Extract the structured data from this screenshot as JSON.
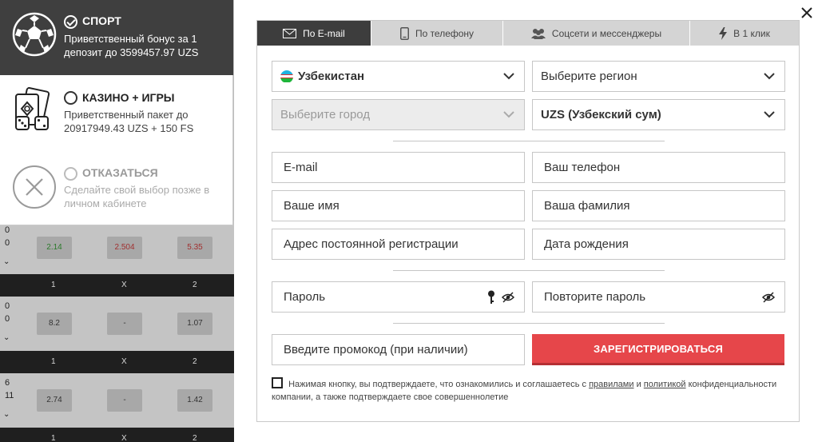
{
  "bonus": {
    "options": [
      {
        "title": "СПОРТ",
        "description": "Приветственный бонус за 1 депозит до 3599457.97 UZS",
        "selected": true,
        "icon": "soccer-ball-icon"
      },
      {
        "title": "КАЗИНО + ИГРЫ",
        "description": "Приветственный пакет до 20917949.43 UZS + 150 FS",
        "selected": false,
        "icon": "casino-cards-dice-icon"
      },
      {
        "title": "ОТКАЗАТЬСЯ",
        "description": "Сделайте свой выбор позже в личном кабинете",
        "selected": false,
        "icon": "decline-x-icon"
      }
    ]
  },
  "background_odds": {
    "rows": [
      {
        "score": [
          "0",
          "0"
        ],
        "odds": [
          "2.14",
          "2.504",
          "5.35"
        ]
      },
      {
        "score": [
          "0",
          "0"
        ],
        "odds": [
          "8.2",
          "-",
          "1.07"
        ]
      },
      {
        "score": [
          "6",
          "11"
        ],
        "odds": [
          "2.74",
          "-",
          "1.42"
        ]
      }
    ],
    "header_labels": [
      "1",
      "X",
      "2"
    ]
  },
  "tabs": [
    {
      "label": "По E-mail",
      "icon": "envelope-icon",
      "active": true
    },
    {
      "label": "По телефону",
      "icon": "phone-icon",
      "active": false
    },
    {
      "label": "Соцсети и мессенджеры",
      "icon": "people-icon",
      "active": false
    },
    {
      "label": "В 1 клик",
      "icon": "lightning-icon",
      "active": false
    }
  ],
  "form": {
    "country": "Узбекистан",
    "region_placeholder": "Выберите регион",
    "city_placeholder": "Выберите город",
    "currency": "UZS (Узбекский сум)",
    "email_placeholder": "E-mail",
    "phone_placeholder": "Ваш телефон",
    "first_name_placeholder": "Ваше имя",
    "last_name_placeholder": "Ваша фамилия",
    "address_placeholder": "Адрес постоянной регистрации",
    "birth_date_placeholder": "Дата рождения",
    "password_placeholder": "Пароль",
    "repeat_password_placeholder": "Повторите пароль",
    "promo_placeholder": "Введите промокод (при наличии)",
    "register_label": "ЗАРЕГИСТРИРОВАТЬСЯ",
    "agree_text_1": "Нажимая кнопку, вы подтверждаете, что ознакомились и соглашаетесь с",
    "agree_link_rules": "правилами",
    "agree_and": "и",
    "agree_link_policy": "политикой",
    "agree_text_2": "конфиденциальности компании, а также подтверждаете свое совершеннолетие"
  },
  "colors": {
    "active_tab": "#3d3d3d",
    "register_button": "#e6464a",
    "flag": [
      "#1eb3e0",
      "#ffffff",
      "#1eb53a"
    ]
  }
}
